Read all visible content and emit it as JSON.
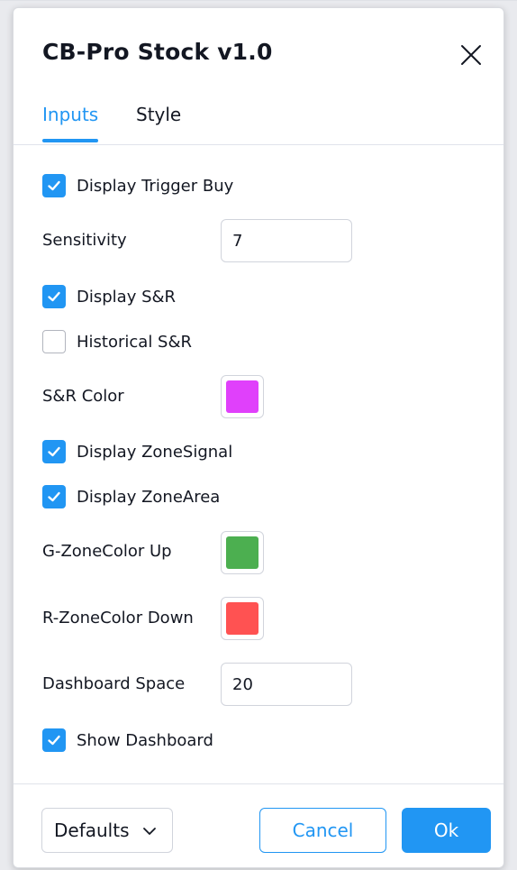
{
  "dialog": {
    "title": "CB-Pro Stock v1.0"
  },
  "tabs": [
    {
      "label": "Inputs",
      "active": true
    },
    {
      "label": "Style",
      "active": false
    }
  ],
  "inputs": {
    "display_trigger_buy": {
      "label": "Display Trigger Buy",
      "checked": true
    },
    "sensitivity": {
      "label": "Sensitivity",
      "value": "7"
    },
    "display_sr": {
      "label": "Display S&R",
      "checked": true
    },
    "historical_sr": {
      "label": "Historical S&R",
      "checked": false
    },
    "sr_color": {
      "label": "S&R Color",
      "color": "#e040fb"
    },
    "display_zone_signal": {
      "label": "Display ZoneSignal",
      "checked": true
    },
    "display_zone_area": {
      "label": "Display ZoneArea",
      "checked": true
    },
    "g_zone_color_up": {
      "label": "G-ZoneColor Up",
      "color": "#4caf50"
    },
    "r_zone_color_down": {
      "label": "R-ZoneColor Down",
      "color": "#ff5252"
    },
    "dashboard_space": {
      "label": "Dashboard Space",
      "value": "20"
    },
    "show_dashboard": {
      "label": "Show Dashboard",
      "checked": true
    }
  },
  "footer": {
    "defaults_label": "Defaults",
    "cancel_label": "Cancel",
    "ok_label": "Ok"
  },
  "colors": {
    "accent": "#2196f3",
    "text": "#131722",
    "border": "#d1d4dc"
  },
  "icons": {
    "close": "close-icon",
    "check": "check-icon",
    "chevron": "chevron-down-icon"
  }
}
